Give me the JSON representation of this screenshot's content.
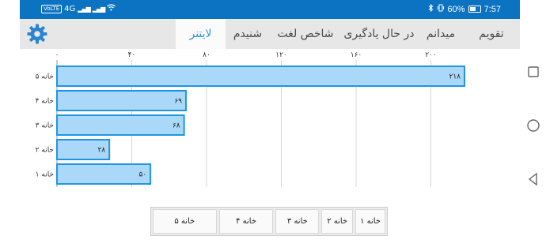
{
  "status_bar": {
    "left_chip": "VoLTE",
    "left_network": "4G",
    "battery_percent": "60%",
    "time": "7:57"
  },
  "toolbar": {
    "settings_icon": "gear-icon",
    "tabs": [
      {
        "label": "لایتنر",
        "active": true
      },
      {
        "label": "شنیدم",
        "active": false
      },
      {
        "label": "شاخص لغت",
        "active": false
      },
      {
        "label": "در حال یادگیری",
        "active": false
      },
      {
        "label": "میدانم",
        "active": false
      },
      {
        "label": "تقویم",
        "active": false
      }
    ]
  },
  "chart_data": {
    "type": "bar",
    "orientation": "horizontal",
    "categories": [
      "خانه ۵",
      "خانه ۴",
      "خانه ۳",
      "خانه ۲",
      "خانه ۱"
    ],
    "values": [
      218,
      69,
      68,
      28,
      50
    ],
    "value_labels": [
      "۲۱۸",
      "۶۹",
      "۶۸",
      "۲۸",
      "۵۰"
    ],
    "x_ticks": [
      {
        "value": 0,
        "label": "۰"
      },
      {
        "value": 40,
        "label": "۴۰"
      },
      {
        "value": 80,
        "label": "۸۰"
      },
      {
        "value": 120,
        "label": "۱۲۰"
      },
      {
        "value": 160,
        "label": "۱۶۰"
      },
      {
        "value": 200,
        "label": "۲۰۰"
      }
    ],
    "xlim": [
      0,
      240
    ],
    "grid": true,
    "bar_fill": "#aad8f8",
    "bar_stroke": "#2196e0",
    "title": "",
    "xlabel": "",
    "ylabel": ""
  },
  "legend": {
    "items": [
      "خانه ۱",
      "خانه ۲",
      "خانه ۳",
      "خانه ۴",
      "خانه ۵"
    ]
  },
  "nav_bar": {
    "buttons": [
      "square-icon",
      "circle-icon",
      "triangle-back-icon"
    ]
  }
}
